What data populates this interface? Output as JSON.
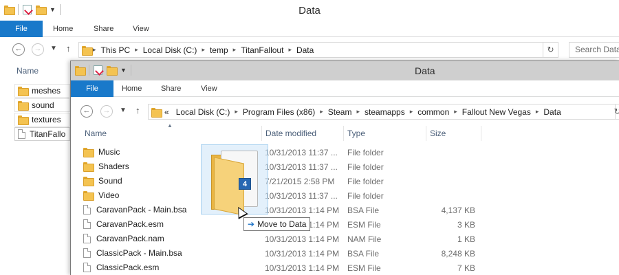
{
  "back_window": {
    "title": "Data",
    "ribbon_tabs": [
      "File",
      "Home",
      "Share",
      "View"
    ],
    "path": [
      "This PC",
      "Local Disk (C:)",
      "temp",
      "TitanFallout",
      "Data"
    ],
    "search_placeholder": "Search Data",
    "column_name": "Name",
    "items": [
      {
        "name": "meshes",
        "icon": "folder-icon"
      },
      {
        "name": "sound",
        "icon": "folder-icon"
      },
      {
        "name": "textures",
        "icon": "folder-icon"
      },
      {
        "name": "TitanFallo",
        "icon": "file-icon"
      }
    ]
  },
  "front_window": {
    "title": "Data",
    "ribbon_tabs": [
      "File",
      "Home",
      "Share",
      "View"
    ],
    "path_overflow": "«",
    "path": [
      "Local Disk (C:)",
      "Program Files (x86)",
      "Steam",
      "steamapps",
      "common",
      "Fallout New Vegas",
      "Data"
    ],
    "columns": [
      "Name",
      "Date modified",
      "Type",
      "Size"
    ],
    "files": [
      {
        "name": "Music",
        "date": "10/31/2013 11:37 ...",
        "type": "File folder",
        "size": "",
        "icon": "folder-icon"
      },
      {
        "name": "Shaders",
        "date": "10/31/2013 11:37 ...",
        "type": "File folder",
        "size": "",
        "icon": "folder-icon"
      },
      {
        "name": "Sound",
        "date": "7/21/2015 2:58 PM",
        "type": "File folder",
        "size": "",
        "icon": "folder-icon"
      },
      {
        "name": "Video",
        "date": "10/31/2013 11:37 ...",
        "type": "File folder",
        "size": "",
        "icon": "folder-icon"
      },
      {
        "name": "CaravanPack - Main.bsa",
        "date": "10/31/2013 1:14 PM",
        "type": "BSA File",
        "size": "4,137 KB",
        "icon": "file-icon"
      },
      {
        "name": "CaravanPack.esm",
        "date": "10/31/2013 1:14 PM",
        "type": "ESM File",
        "size": "3 KB",
        "icon": "file-icon"
      },
      {
        "name": "CaravanPack.nam",
        "date": "10/31/2013 1:14 PM",
        "type": "NAM File",
        "size": "1 KB",
        "icon": "file-icon"
      },
      {
        "name": "ClassicPack - Main.bsa",
        "date": "10/31/2013 1:14 PM",
        "type": "BSA File",
        "size": "8,248 KB",
        "icon": "file-icon"
      },
      {
        "name": "ClassicPack.esm",
        "date": "10/31/2013 1:14 PM",
        "type": "ESM File",
        "size": "7 KB",
        "icon": "file-icon"
      }
    ]
  },
  "drag": {
    "count": "4",
    "tooltip": "Move to Data"
  },
  "colors": {
    "file_tab": "#1979ca",
    "folder": "#f4c351",
    "badge": "#2767b2"
  }
}
